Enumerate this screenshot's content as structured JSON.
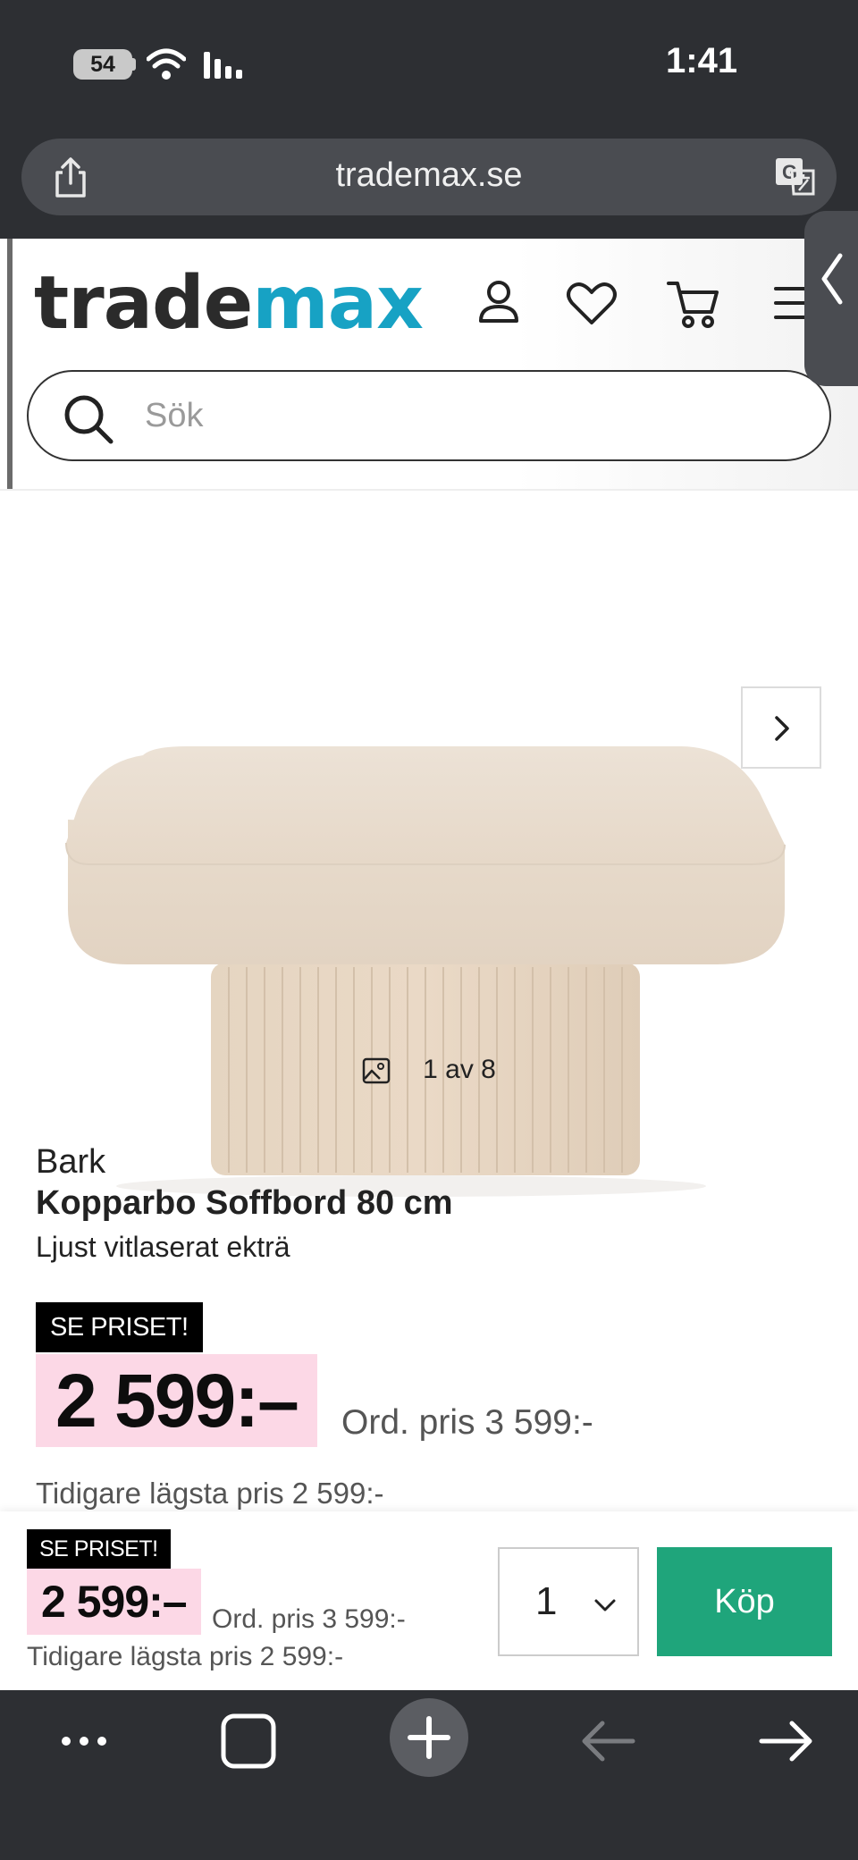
{
  "status_bar": {
    "battery": "54",
    "time": "1:41"
  },
  "browser": {
    "url": "trademax.se",
    "icons": [
      "share-icon",
      "translate-icon",
      "wifi-icon",
      "signal-icon"
    ]
  },
  "header": {
    "logo_part1": "trade",
    "logo_part2": "max",
    "icons": [
      "account-icon",
      "heart-icon",
      "cart-icon",
      "menu-icon"
    ],
    "search_placeholder": "Sök"
  },
  "gallery": {
    "counter": "1 av 8"
  },
  "product": {
    "brand": "Bark",
    "name": "Kopparbo Soffbord 80 cm",
    "color": "Ljust vitlaserat ekträ",
    "badge": "SE PRISET!",
    "price": "2 599:–",
    "ordinary_price": "Ord. pris 3 599:-",
    "lowest_price": "Tidigare lägsta pris 2 599:-"
  },
  "buy_bar": {
    "badge": "SE PRISET!",
    "price": "2 599:–",
    "ordinary_price": "Ord. pris 3 599:-",
    "lowest_price": "Tidigare lägsta pris 2 599:-",
    "quantity": "1",
    "buy_label": "Köp"
  },
  "colors": {
    "brand_teal": "#17a2c4",
    "buy_green": "#1fa57b",
    "price_pink": "#fcd8e6",
    "chrome_dark": "#2d2f33"
  }
}
